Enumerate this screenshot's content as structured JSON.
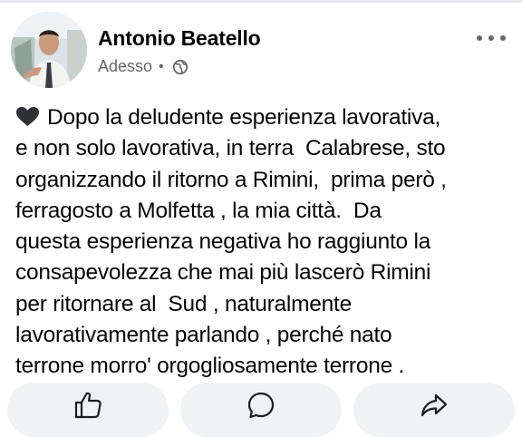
{
  "post": {
    "author": "Antonio Beatello",
    "timestamp": "Adesso",
    "separator": "•",
    "privacy_icon": "globe-icon",
    "menu_icon": "more-horizontal-icon",
    "emoji_icon": "black-heart-icon",
    "lines": [
      "Dopo la deludente esperienza lavorativa,",
      "e non solo lavorativa, in terra  Calabrese, sto",
      "organizzando il ritorno a Rimini,  prima però ,",
      "ferragosto a Molfetta , la mia città.  Da",
      "questa esperienza negativa ho raggiunto la",
      "consapevolezza che mai più lascerò Rimini",
      "per ritornare al  Sud , naturalmente",
      "lavorativamente parlando , perché nato",
      "terrone morro' orgogliosamente terrone ."
    ]
  },
  "actions": [
    {
      "icon": "thumbs-up-icon"
    },
    {
      "icon": "comment-icon"
    },
    {
      "icon": "share-icon"
    }
  ],
  "colors": {
    "text": "#050505",
    "secondary_text": "#65676b",
    "action_bg": "#f0f2f5",
    "icon": "#1c1e21"
  }
}
